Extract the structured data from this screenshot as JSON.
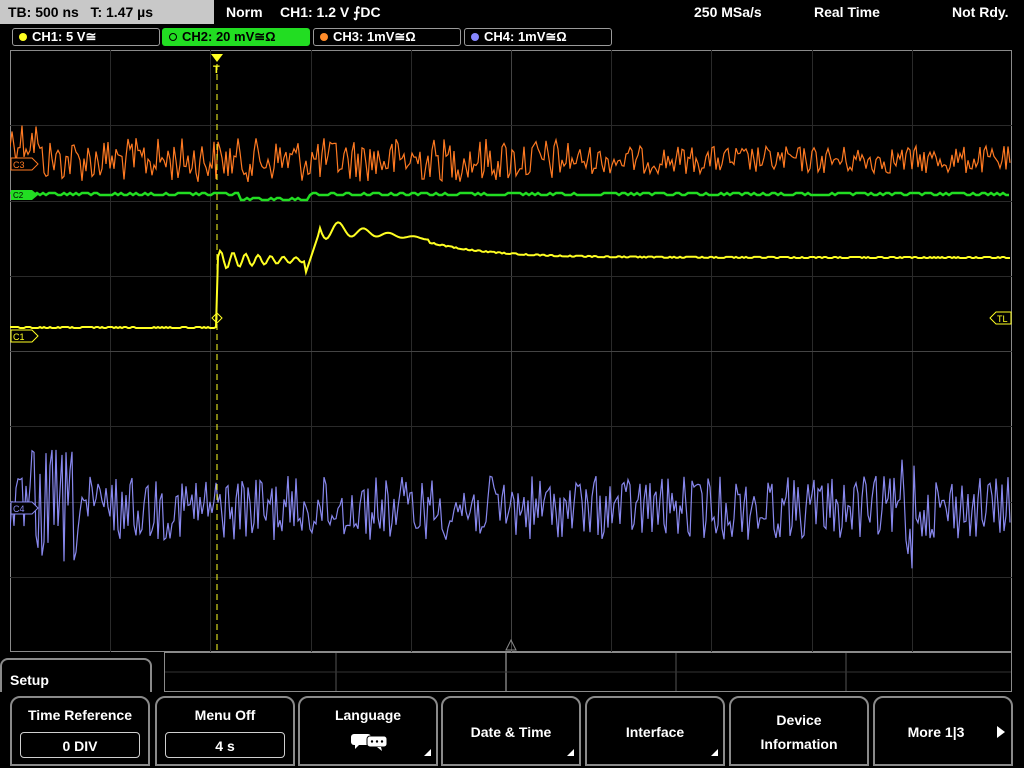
{
  "status_bar": {
    "timebase": "TB: 500 ns   T: 1.47 µs",
    "mode": "Norm",
    "trigger": "CH1: 1.2 V ⨍DC",
    "sample_rate": "250 MSa/s",
    "acquisition": "Real Time",
    "state": "Not Rdy."
  },
  "channels": [
    {
      "label": "CH1: 5 V≅",
      "color": "#ffff22",
      "active": false
    },
    {
      "label": "CH2: 20 mV≅Ω",
      "color": "#22dd22",
      "active": true
    },
    {
      "label": "CH3: 1mV≅Ω",
      "color": "#ff8c2a",
      "active": false
    },
    {
      "label": "CH4: 1mV≅Ω",
      "color": "#8888ff",
      "active": false
    }
  ],
  "scope_markers": {
    "c3": "C3",
    "c2": "C2",
    "c1": "C1",
    "c4": "C4",
    "trigger_level": "TL",
    "trigger_position": "T"
  },
  "menu": {
    "title": "Setup",
    "softkeys": [
      {
        "title": "Time Reference",
        "value": "0 DIV"
      },
      {
        "title": "Menu Off",
        "value": "4 s"
      },
      {
        "title": "Language",
        "icon": "speech-bubble-icon"
      },
      {
        "title": "Date & Time"
      },
      {
        "title": "Interface"
      },
      {
        "title_line1": "Device",
        "title_line2": "Information"
      },
      {
        "title": "More 1|3"
      }
    ]
  }
}
